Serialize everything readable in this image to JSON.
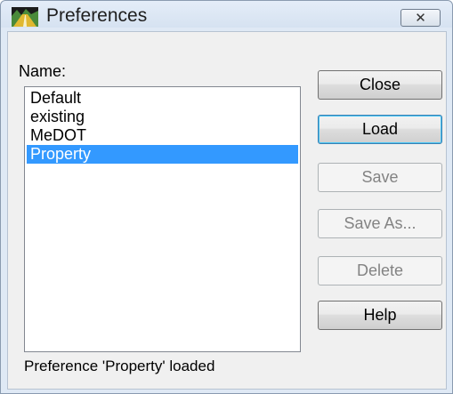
{
  "window": {
    "title": "Preferences",
    "close_glyph": "✕",
    "app_icon": "mountain-road-icon",
    "close_icon": "close-icon"
  },
  "list": {
    "label": "Name:",
    "items": [
      {
        "label": "Default",
        "selected": false
      },
      {
        "label": "existing",
        "selected": false
      },
      {
        "label": "MeDOT",
        "selected": false
      },
      {
        "label": "Property",
        "selected": true
      }
    ]
  },
  "buttons": {
    "close": {
      "label": "Close",
      "enabled": true
    },
    "load": {
      "label": "Load",
      "enabled": true
    },
    "save": {
      "label": "Save",
      "enabled": false
    },
    "save_as": {
      "label": "Save As...",
      "enabled": false
    },
    "delete": {
      "label": "Delete",
      "enabled": false
    },
    "help": {
      "label": "Help",
      "enabled": true
    }
  },
  "status": {
    "text": "Preference 'Property' loaded"
  },
  "colors": {
    "selection": "#3399ff",
    "window_frame": "#dfe9f5",
    "dialog_bg": "#f0f0f0"
  }
}
